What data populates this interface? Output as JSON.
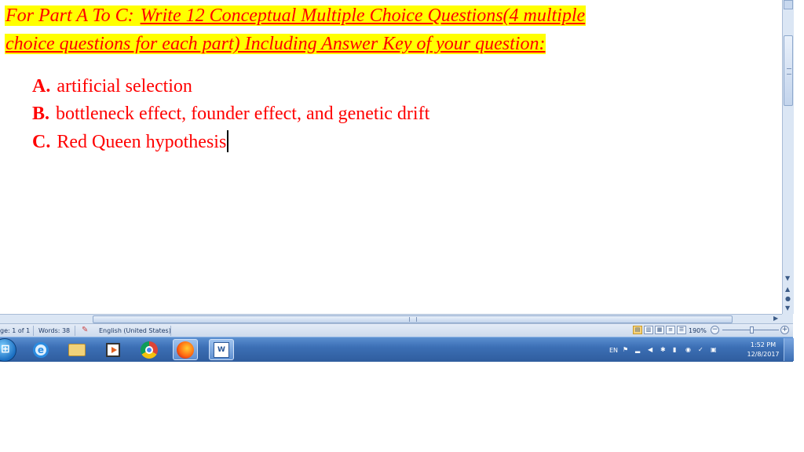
{
  "document": {
    "heading_line1_part1": "For Part A To C: ",
    "heading_line1_part2": "Write 12 Conceptual Multiple Choice Questions(4 multiple",
    "heading_line2": "choice questions for each part) Including Answer Key of your question:",
    "items": [
      {
        "letter": "A.",
        "text": "artificial selection"
      },
      {
        "letter": "B.",
        "text": "bottleneck effect, founder effect, and genetic drift"
      },
      {
        "letter": "C.",
        "text": "Red Queen hypothesis"
      }
    ],
    "text_color": "#ff0000",
    "highlight_color": "#ffff00"
  },
  "statusbar": {
    "page": "ge: 1 of 1",
    "words": "Words: 38",
    "language": "English (United States)",
    "zoom": "190%"
  },
  "taskbar": {
    "apps": [
      "start-orb",
      "internet-explorer-icon",
      "file-explorer-icon",
      "media-player-icon",
      "chrome-icon",
      "firefox-icon",
      "word-icon"
    ],
    "tray_language": "EN",
    "time": "1:52 PM",
    "date": "12/8/2017"
  }
}
